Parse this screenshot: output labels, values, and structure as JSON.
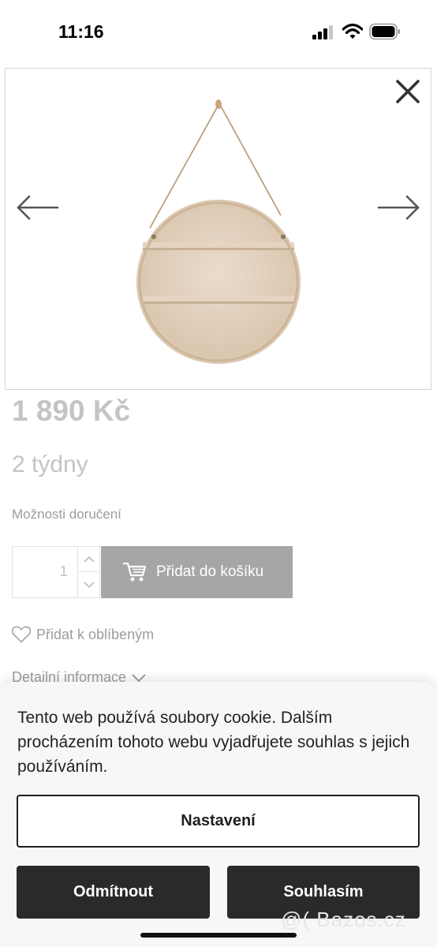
{
  "status_bar": {
    "time": "11:16",
    "icons": [
      "signal-icon",
      "wifi-icon",
      "battery-icon"
    ]
  },
  "gallery": {
    "icons": [
      "close-icon",
      "arrow-left-icon",
      "arrow-right-icon"
    ],
    "image": "round-wooden-wall-shelf"
  },
  "product": {
    "price": "1 890 Kč",
    "delivery_time": "2 týdny",
    "delivery_options_label": "Možnosti doručení",
    "quantity": "1",
    "add_to_cart_label": "Přidat do košíku",
    "favorite_label": "Přidat k oblíbeným",
    "details_label": "Detailní informace"
  },
  "cookie_banner": {
    "text": "Tento web používá soubory cookie. Dalším procházením tohoto webu vyjadřujete souhlas s jejich používáním.",
    "settings_label": "Nastavení",
    "reject_label": "Odmítnout",
    "accept_label": "Souhlasím"
  },
  "watermark": "@( Bazos.cz",
  "colors": {
    "price_text": "#c4c4c4",
    "cart_button": "#a6a6a6",
    "dark_button": "#2a2a2a",
    "sheet_background": "#f7f7f9"
  }
}
